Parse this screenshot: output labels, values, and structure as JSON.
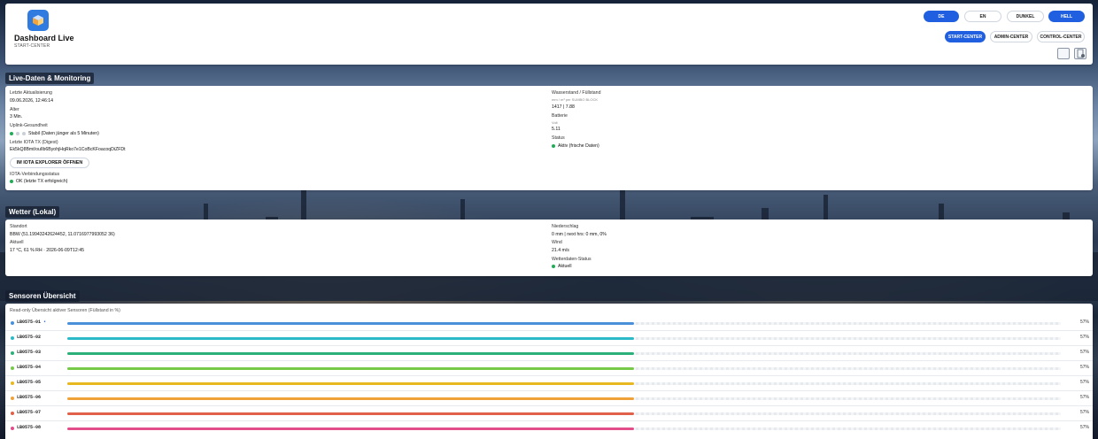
{
  "header": {
    "app_title": "Dashboard Live",
    "app_subtitle": "START-CENTER",
    "lang_buttons": [
      "DE",
      "EN"
    ],
    "theme_buttons": [
      "DUNKEL",
      "HELL"
    ],
    "nav_buttons": [
      "START-CENTER",
      "ADMIN-CENTER",
      "CONTROL-CENTER"
    ],
    "active": {
      "lang": "DE",
      "theme": "HELL",
      "nav": "START-CENTER"
    }
  },
  "live": {
    "title": "Live-Daten & Monitoring",
    "last_update_label": "Letzte Aktualisierung",
    "last_update_value": "09.06.2026, 12:46:14",
    "age_label": "Alter",
    "age_value": "3 Min.",
    "uplink_label": "Uplink-Gesundheit",
    "uplink_value": "Stabil (Daten jünger als 5 Minuten)",
    "iota_tx_label": "Letzte IOTA TX (Digest)",
    "iota_tx_value": "Ek5kQ8Bmt/ouIlb6ByohjHqRko7e1CoBcKFoacoqDiZFDt",
    "explorer_button": "IM IOTA EXPLORER ÖFFNEN",
    "iota_conn_label": "IOTA-Verbindungsstatus",
    "iota_conn_value": "OK (letzte TX erfolgreich)",
    "water_label": "Wasserstand / Füllstand",
    "water_unit": "mm / m³ per SUMBO BLOCK",
    "water_value": "1417 | 7.88",
    "battery_label": "Batterie",
    "battery_unit": "Volt",
    "battery_value": "5.11",
    "status_label": "Status",
    "status_value": "Aktiv (frische Daten)"
  },
  "weather": {
    "title": "Wetter (Lokal)",
    "location_label": "Standort",
    "location_value": "BBW (51.19943242624452, 11.0716977993052 36)",
    "current_label": "Aktuell",
    "current_value": "17 °C, 61 % RH · 2026-06-09T12:45",
    "precip_label": "Niederschlag",
    "precip_value": "0 mm | next hrs: 0 mm, 0%",
    "wind_label": "Wind",
    "wind_value": "21.4 m/s",
    "status_label": "Wetterdaten-Status",
    "status_value": "Aktuell"
  },
  "sensors": {
    "title": "Sensoren Übersicht",
    "subtitle": "Read-only Übersicht aktiver Sensoren (Füllstand in %)",
    "items": [
      {
        "name": "LB0575-01",
        "flag": "•",
        "percent": 57,
        "label": "57%",
        "color": "#4a90d9"
      },
      {
        "name": "LB0575-02",
        "flag": "",
        "percent": 57,
        "label": "57%",
        "color": "#2cb9c8"
      },
      {
        "name": "LB0575-03",
        "flag": "",
        "percent": 57,
        "label": "57%",
        "color": "#2bb07a"
      },
      {
        "name": "LB0575-04",
        "flag": "",
        "percent": 57,
        "label": "57%",
        "color": "#77c94a"
      },
      {
        "name": "LB0575-05",
        "flag": "",
        "percent": 57,
        "label": "57%",
        "color": "#e8b820"
      },
      {
        "name": "LB0575-06",
        "flag": "",
        "percent": 57,
        "label": "57%",
        "color": "#f0a23a"
      },
      {
        "name": "LB0575-07",
        "flag": "",
        "percent": 57,
        "label": "57%",
        "color": "#e0604a"
      },
      {
        "name": "LB0575-08",
        "flag": "",
        "percent": 57,
        "label": "57%",
        "color": "#e24d8a"
      }
    ]
  }
}
